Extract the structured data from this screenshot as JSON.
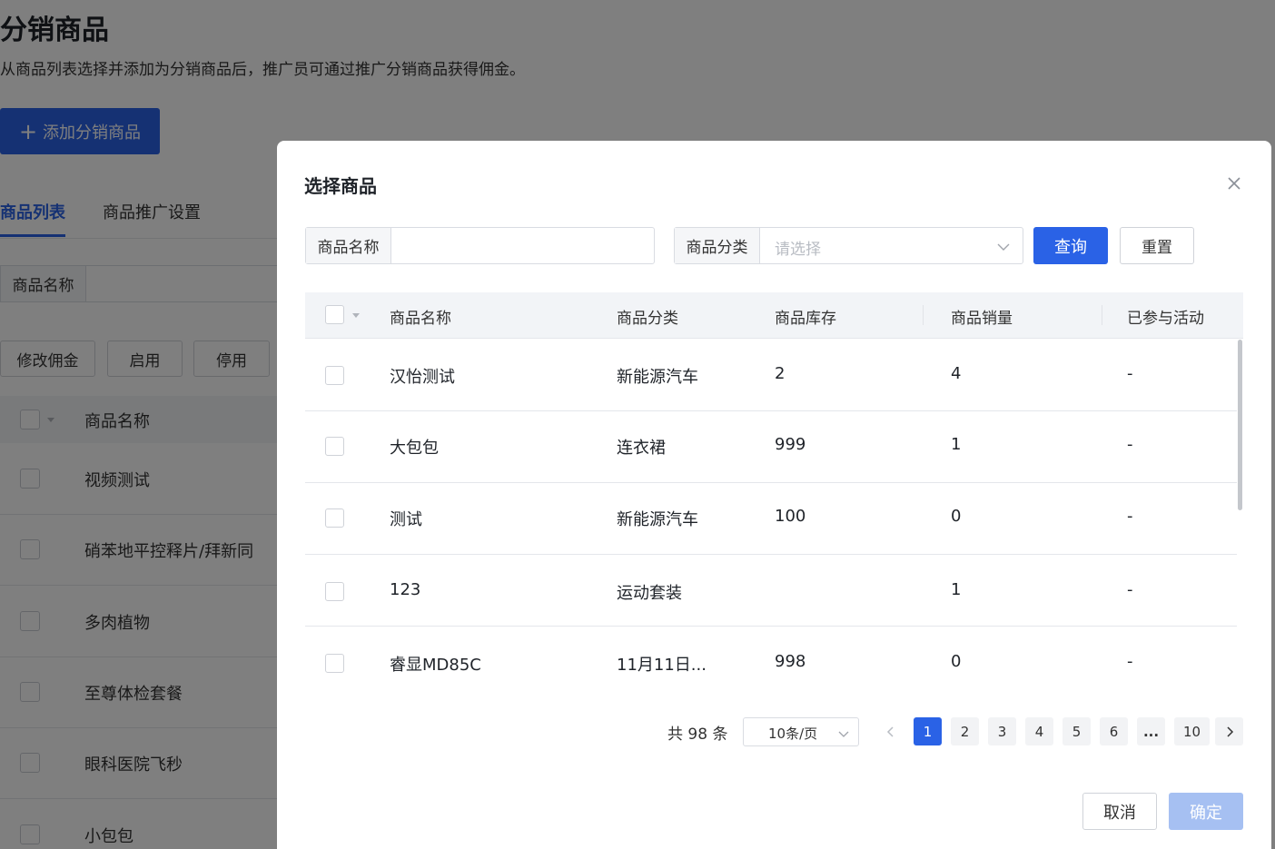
{
  "page": {
    "title": "分销商品",
    "description": "从商品列表选择并添加为分销商品后，推广员可通过推广分销商品获得佣金。",
    "add_button_label": "添加分销商品",
    "add_button_icon": "plus-icon",
    "tabs": [
      {
        "label": "商品列表",
        "active": true
      },
      {
        "label": "商品推广设置",
        "active": false
      }
    ],
    "filter_label": "商品名称",
    "action_buttons": [
      "修改佣金",
      "启用",
      "停用"
    ],
    "table_header_name": "商品名称",
    "rows": [
      "视频测试",
      "硝苯地平控释片/拜新同",
      "多肉植物",
      "至尊体检套餐",
      "眼科医院飞秒",
      "小包包"
    ]
  },
  "modal": {
    "title": "选择商品",
    "close_icon": "close-icon",
    "search": {
      "name_label": "商品名称",
      "name_value": "",
      "category_label": "商品分类",
      "category_placeholder": "请选择",
      "query_label": "查询",
      "reset_label": "重置"
    },
    "table": {
      "columns": [
        "商品名称",
        "商品分类",
        "商品库存",
        "商品销量",
        "已参与活动"
      ],
      "rows": [
        {
          "name": "汉怡测试",
          "category": "新能源汽车",
          "stock": "2",
          "sales": "4",
          "activity": "-"
        },
        {
          "name": "大包包",
          "category": "连衣裙",
          "stock": "999",
          "sales": "1",
          "activity": "-"
        },
        {
          "name": "测试",
          "category": "新能源汽车",
          "stock": "100",
          "sales": "0",
          "activity": "-"
        },
        {
          "name": "123",
          "category": "运动套装",
          "stock": "",
          "sales": "1",
          "activity": "-"
        },
        {
          "name": "睿显MD85C",
          "category": "11月11日...",
          "stock": "998",
          "sales": "0",
          "activity": "-"
        }
      ]
    },
    "pagination": {
      "total_text": "共 98 条",
      "page_size": "10条/页",
      "pages": [
        "1",
        "2",
        "3",
        "4",
        "5",
        "6",
        "...",
        "10"
      ],
      "current_page": "1"
    },
    "footer": {
      "cancel_label": "取消",
      "ok_label": "确定"
    }
  },
  "colors": {
    "primary": "#2a62e6",
    "primary_disabled": "#a6c0f2",
    "overlay": "rgba(0,0,0,0.5)"
  }
}
